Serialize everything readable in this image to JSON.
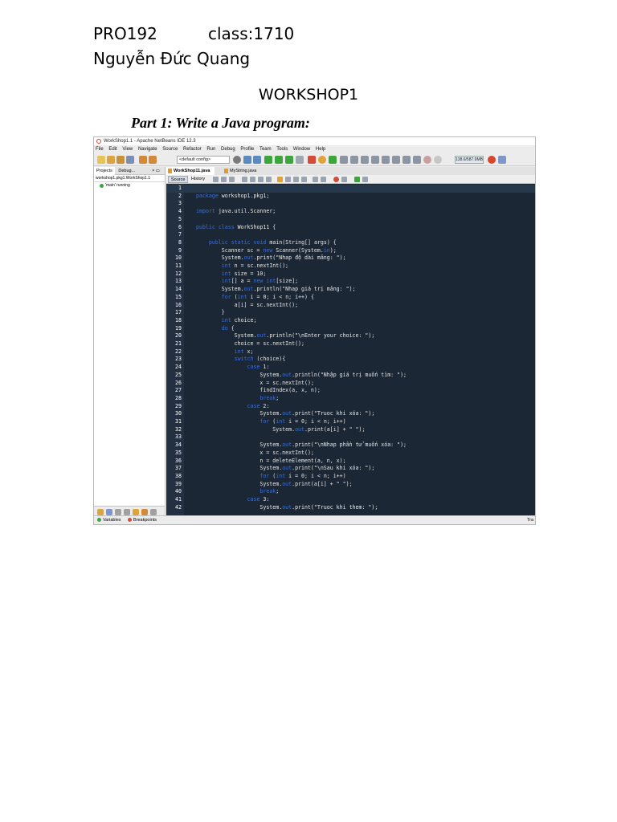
{
  "header": {
    "course": "PRO192",
    "class": "class:1710",
    "name": "Nguyễn Đức Quang",
    "title": "WORKSHOP1",
    "part": "Part 1:  Write a Java program:"
  },
  "ide": {
    "window_title": "WorkShop1.1 - Apache NetBeans IDE 12.3",
    "menu": [
      "File",
      "Edit",
      "View",
      "Navigate",
      "Source",
      "Refactor",
      "Run",
      "Debug",
      "Profile",
      "Team",
      "Tools",
      "Window",
      "Help"
    ],
    "config_select": "<default config>",
    "memory": "138.6/587.9MB",
    "left_panel": {
      "tabs": [
        "Projects",
        "Debug..."
      ],
      "controls": "× ▭",
      "path": "workshop1.pkg1.WorkShop1.1",
      "thread": "'main' running"
    },
    "editor": {
      "tabs": [
        "WorkShop11.java",
        "MyString.java"
      ],
      "modes": [
        "Source",
        "History"
      ],
      "lines": [
        {
          "n": "1",
          "code": "",
          "current": true
        },
        {
          "n": "2",
          "code": "package workshop1.pkg1;"
        },
        {
          "n": "3",
          "code": ""
        },
        {
          "n": "4",
          "code": "import java.util.Scanner;"
        },
        {
          "n": "5",
          "code": ""
        },
        {
          "n": "6",
          "code": "public class WorkShop11 {"
        },
        {
          "n": "7",
          "code": ""
        },
        {
          "n": "8",
          "code": "    public static void main(String[] args) {"
        },
        {
          "n": "9",
          "code": "        Scanner sc = new Scanner(System.in);"
        },
        {
          "n": "10",
          "code": "        System.out.print(\"Nhap độ dài mảng: \");"
        },
        {
          "n": "11",
          "code": "        int n = sc.nextInt();"
        },
        {
          "n": "12",
          "code": "        int size = 10;"
        },
        {
          "n": "13",
          "code": "        int[] a = new int[size];"
        },
        {
          "n": "14",
          "code": "        System.out.println(\"Nhap giá trị mảng: \");"
        },
        {
          "n": "15",
          "code": "        for (int i = 0; i < n; i++) {"
        },
        {
          "n": "16",
          "code": "            a[i] = sc.nextInt();"
        },
        {
          "n": "17",
          "code": "        }"
        },
        {
          "n": "18",
          "code": "        int choice;"
        },
        {
          "n": "19",
          "code": "        do {"
        },
        {
          "n": "20",
          "code": "            System.out.println(\"\\nEnter your choice: \");"
        },
        {
          "n": "21",
          "code": "            choice = sc.nextInt();"
        },
        {
          "n": "22",
          "code": "            int x;"
        },
        {
          "n": "23",
          "code": "            switch (choice){"
        },
        {
          "n": "24",
          "code": "                case 1:"
        },
        {
          "n": "25",
          "code": "                    System.out.println(\"Nhập giá trị muốn tìm: \");"
        },
        {
          "n": "26",
          "code": "                    x = sc.nextInt();"
        },
        {
          "n": "27",
          "code": "                    findIndex(a, x, n);"
        },
        {
          "n": "28",
          "code": "                    break;"
        },
        {
          "n": "29",
          "code": "                case 2:"
        },
        {
          "n": "30",
          "code": "                    System.out.print(\"Truoc khi xóa: \");"
        },
        {
          "n": "31",
          "code": "                    for (int i = 0; i < n; i++)"
        },
        {
          "n": "32",
          "code": "                        System.out.print(a[i] + \" \");"
        },
        {
          "n": "33",
          "code": ""
        },
        {
          "n": "34",
          "code": "                    System.out.print(\"\\nNhap phần tử muốn xóa: \");"
        },
        {
          "n": "35",
          "code": "                    x = sc.nextInt();"
        },
        {
          "n": "36",
          "code": "                    n = deleteElement(a, n, x);"
        },
        {
          "n": "37",
          "code": "                    System.out.print(\"\\nSau khi xóa: \");"
        },
        {
          "n": "38",
          "code": "                    for (int i = 0; i < n; i++)"
        },
        {
          "n": "39",
          "code": "                    System.out.print(a[i] + \" \");"
        },
        {
          "n": "40",
          "code": "                    break;"
        },
        {
          "n": "41",
          "code": "                case 3:"
        },
        {
          "n": "42",
          "code": "                    System.out.print(\"Truoc khi them: \");"
        }
      ]
    },
    "status": {
      "variables": "Variables",
      "breakpoints": "Breakpoints",
      "right": "Tra"
    }
  }
}
